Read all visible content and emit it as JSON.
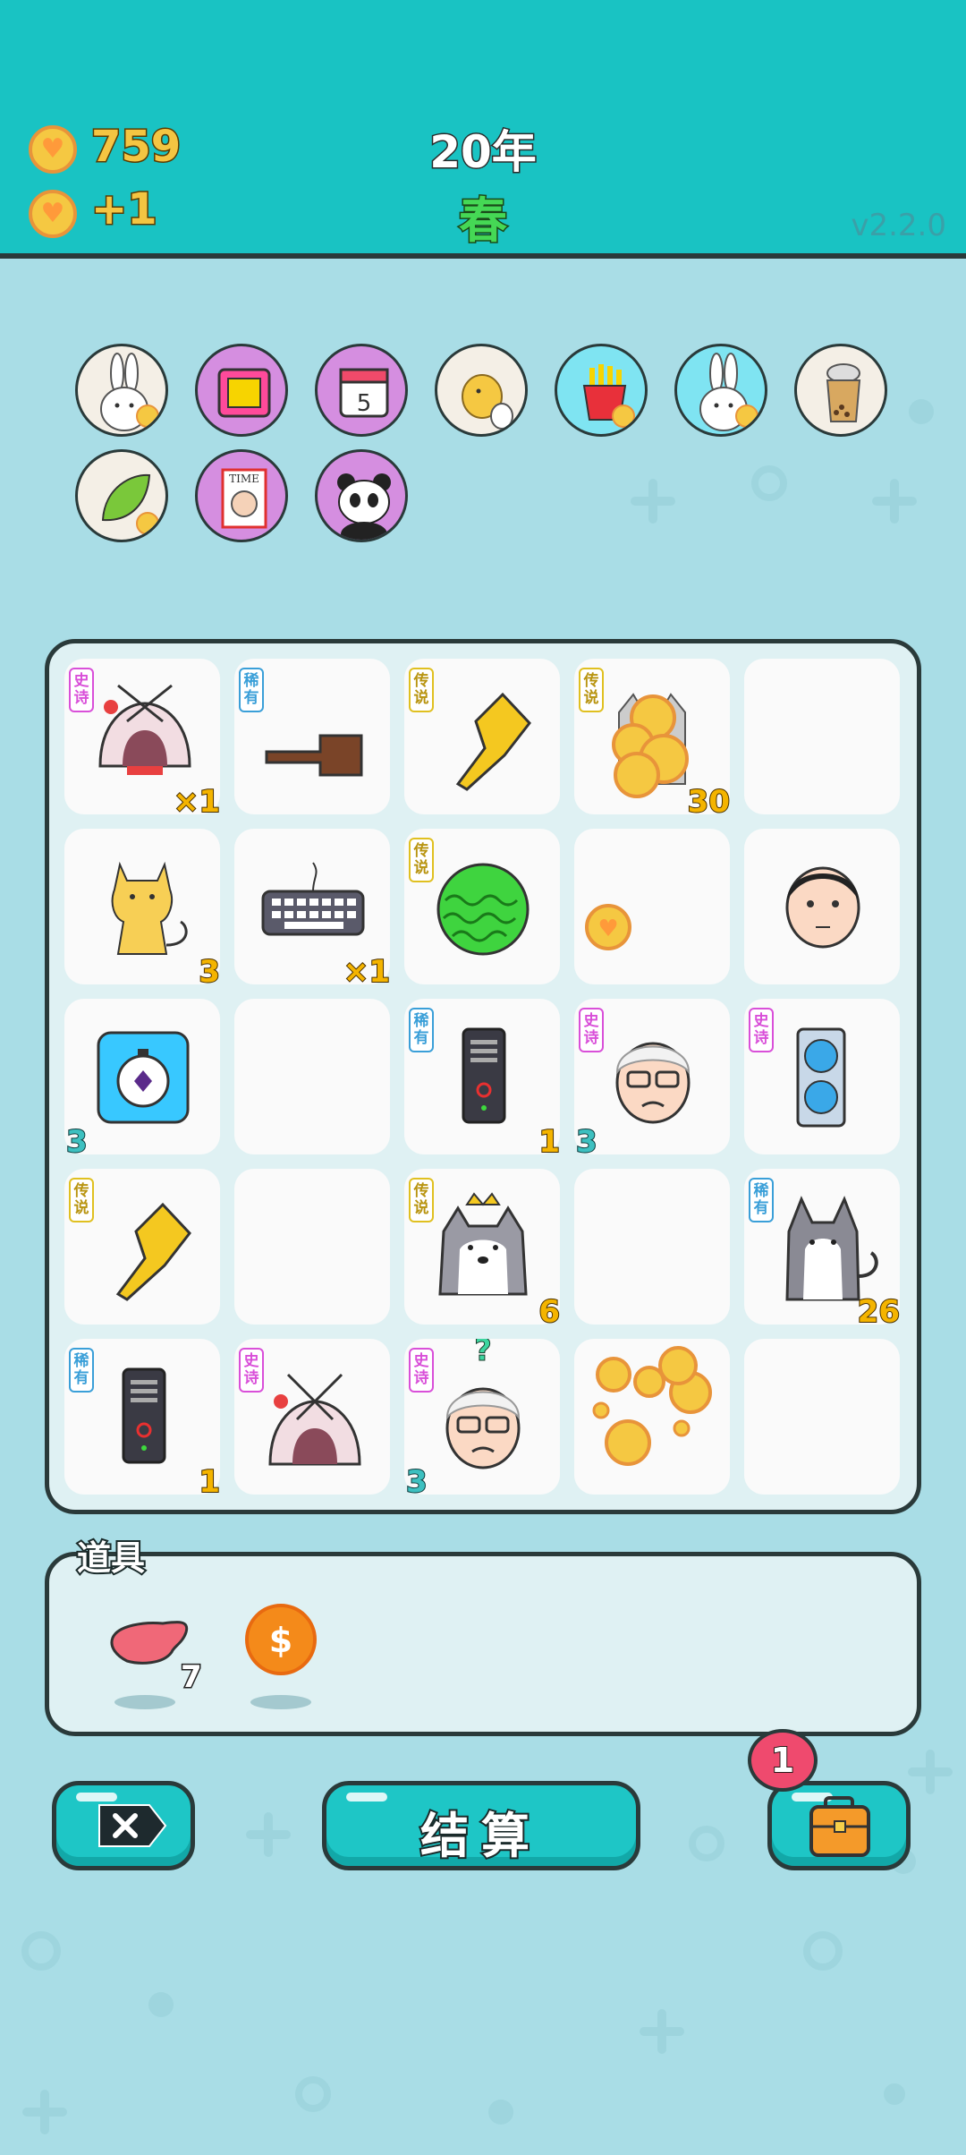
{
  "header": {
    "coins": "759",
    "income": "+1",
    "year": "20年",
    "season": "春",
    "version": "v2.2.0"
  },
  "characters_row1": [
    "bunny-icon",
    "tv-icon",
    "calendar-icon",
    "chick-egg-icon",
    "fries-icon",
    "bunny-icon",
    "milk-tea-icon"
  ],
  "characters_row2": [
    "leaf-icon",
    "time-magazine-icon",
    "panda-icon"
  ],
  "calendar_day": "5",
  "time_label": "TIME",
  "board": {
    "r0": [
      {
        "tag": "史诗",
        "rarity": "epic",
        "icon": "rabbit-tent-icon",
        "count": "×1"
      },
      {
        "tag": "稀有",
        "rarity": "rare",
        "icon": "brown-hand-icon",
        "count": ""
      },
      {
        "tag": "传说",
        "rarity": "legendary",
        "icon": "gold-hand-icon",
        "count": ""
      },
      {
        "tag": "传说",
        "rarity": "legendary",
        "icon": "husky-coins-icon",
        "count": "30"
      },
      {
        "tag": "",
        "rarity": "",
        "icon": "",
        "count": ""
      }
    ],
    "r1": [
      {
        "tag": "",
        "rarity": "",
        "icon": "cat-icon",
        "count": "3"
      },
      {
        "tag": "",
        "rarity": "",
        "icon": "keyboard-icon",
        "count": "×1"
      },
      {
        "tag": "传说",
        "rarity": "legendary",
        "icon": "watermelon-icon",
        "count": ""
      },
      {
        "tag": "",
        "rarity": "",
        "icon": "coin-icon",
        "count": ""
      },
      {
        "tag": "",
        "rarity": "",
        "icon": "man-face-icon",
        "count": ""
      }
    ],
    "r2": [
      {
        "tag": "",
        "rarity": "",
        "icon": "stopwatch-icon",
        "count": "3"
      },
      {
        "tag": "",
        "rarity": "",
        "icon": "",
        "count": ""
      },
      {
        "tag": "稀有",
        "rarity": "rare",
        "icon": "pc-tower-icon",
        "count": "1"
      },
      {
        "tag": "史诗",
        "rarity": "epic",
        "icon": "grandpa-icon",
        "count": "3"
      },
      {
        "tag": "史诗",
        "rarity": "epic",
        "icon": "graphics-card-icon",
        "count": ""
      }
    ],
    "r3": [
      {
        "tag": "传说",
        "rarity": "legendary",
        "icon": "gold-hand-icon",
        "count": ""
      },
      {
        "tag": "",
        "rarity": "",
        "icon": "",
        "count": ""
      },
      {
        "tag": "传说",
        "rarity": "legendary",
        "icon": "crowned-husky-icon",
        "count": "6"
      },
      {
        "tag": "",
        "rarity": "",
        "icon": "",
        "count": ""
      },
      {
        "tag": "稀有",
        "rarity": "rare",
        "icon": "husky-icon",
        "count": "26"
      }
    ],
    "r4": [
      {
        "tag": "稀有",
        "rarity": "rare",
        "icon": "pc-tower-icon",
        "count": "1"
      },
      {
        "tag": "史诗",
        "rarity": "epic",
        "icon": "rabbit-tent-icon",
        "count": ""
      },
      {
        "tag": "史诗",
        "rarity": "epic",
        "icon": "grandpa-question-icon",
        "count": "3"
      },
      {
        "tag": "",
        "rarity": "",
        "icon": "coin-pile-icon",
        "count": ""
      },
      {
        "tag": "",
        "rarity": "",
        "icon": "",
        "count": ""
      }
    ]
  },
  "question_mark": "?",
  "props": {
    "title": "道具",
    "items": [
      {
        "icon": "liver-icon",
        "count": "7"
      },
      {
        "icon": "dollar-coin-icon",
        "count": ""
      }
    ]
  },
  "buttons": {
    "settle": "结算",
    "bag_badge": "1"
  },
  "colors": {
    "header": "#19c3c3",
    "background": "#a9dde6",
    "accent_gold": "#f4c542",
    "epic": "#d94fd9",
    "rare": "#3a9fd8",
    "legendary": "#e0c020"
  }
}
